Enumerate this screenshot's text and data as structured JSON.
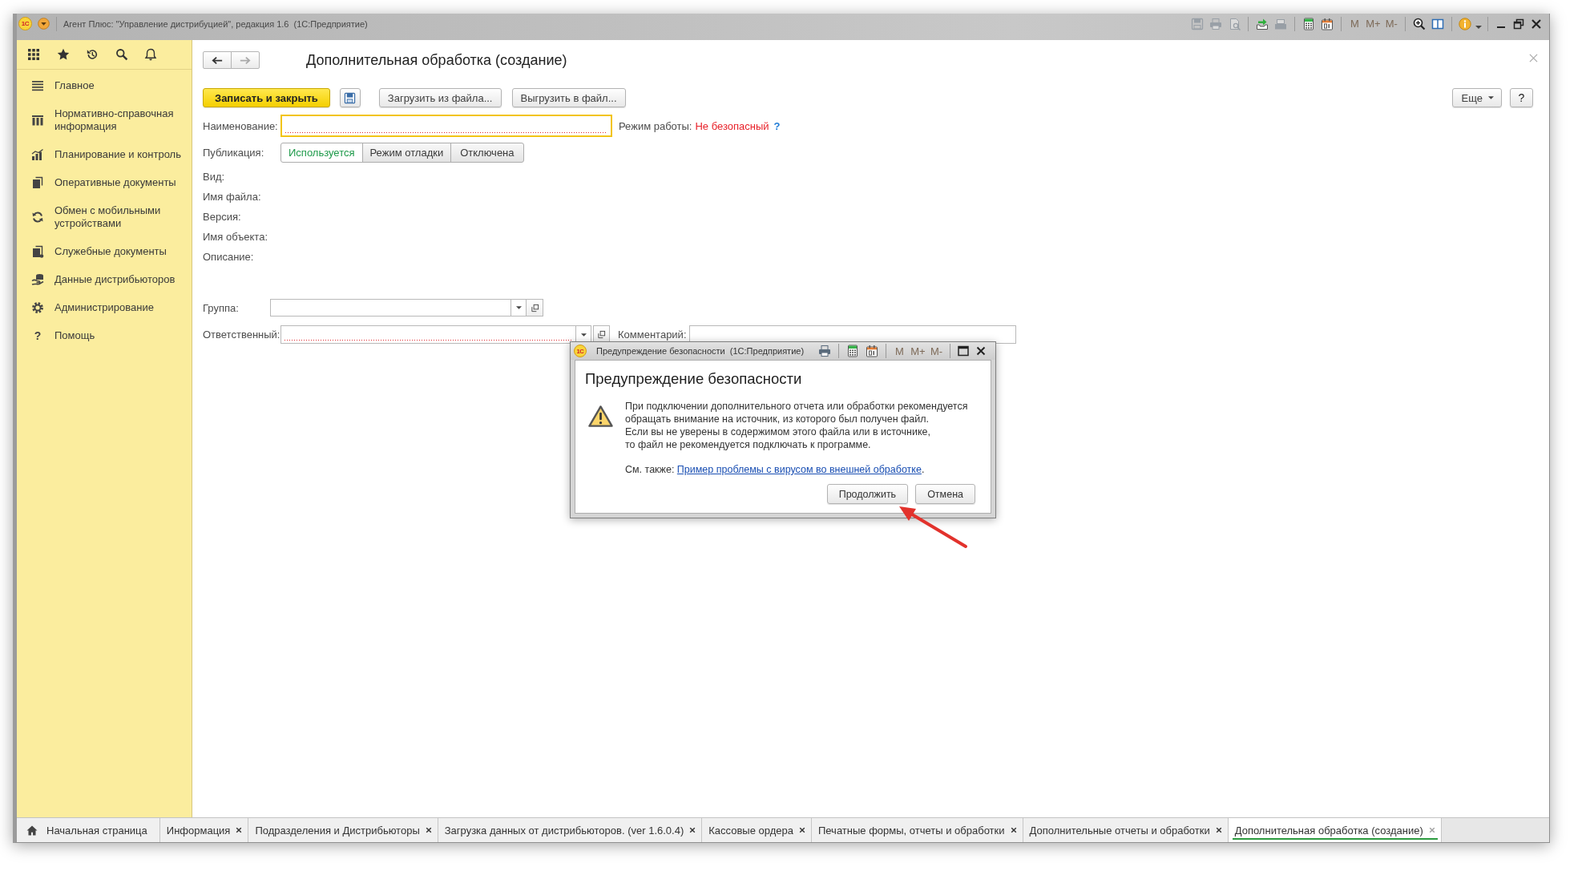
{
  "window": {
    "logo": "1С",
    "title": "Агент Плюс: \"Управление дистрибуцией\", редакция 1.6  (1С:Предприятие)",
    "tool_groups": [
      [
        {
          "kind": "save",
          "disabled": true
        },
        {
          "kind": "print",
          "disabled": true
        },
        {
          "kind": "preview",
          "disabled": true
        }
      ],
      [
        {
          "kind": "export",
          "disabled": false
        },
        {
          "kind": "scanner",
          "disabled": true
        }
      ],
      [
        {
          "kind": "calculator",
          "disabled": false
        },
        {
          "kind": "calendar",
          "disabled": false
        }
      ],
      [
        {
          "kind": "memory",
          "label": "M",
          "disabled": true
        },
        {
          "kind": "memory",
          "label": "M+",
          "disabled": true
        },
        {
          "kind": "memory",
          "label": "M-",
          "disabled": true
        }
      ],
      [
        {
          "kind": "zoom",
          "disabled": false
        },
        {
          "kind": "panels",
          "disabled": false
        }
      ],
      [
        {
          "kind": "info",
          "disabled": false
        }
      ]
    ]
  },
  "sidebar": {
    "items": [
      {
        "kind": "main",
        "label": "Главное"
      },
      {
        "kind": "catalogs",
        "label": "Нормативно-справочная информация"
      },
      {
        "kind": "planning",
        "label": "Планирование и контроль"
      },
      {
        "kind": "documents",
        "label": "Оперативные документы"
      },
      {
        "kind": "exchange",
        "label": "Обмен с мобильными устройствами"
      },
      {
        "kind": "service",
        "label": "Служебные документы"
      },
      {
        "kind": "distributors",
        "label": "Данные дистрибьюторов"
      },
      {
        "kind": "admin",
        "label": "Администрирование"
      },
      {
        "kind": "help",
        "label": "Помощь",
        "glyph": "?"
      }
    ]
  },
  "form": {
    "title": "Дополнительная обработка (создание)",
    "nav": [
      {
        "kind": "back",
        "disabled": false
      },
      {
        "kind": "forward",
        "disabled": true
      }
    ],
    "toolbar": [
      {
        "kind": "primary",
        "label": "Записать и закрыть"
      },
      {
        "kind": "save"
      },
      {
        "kind": "default",
        "label": "Загрузить из файла..."
      },
      {
        "kind": "default",
        "label": "Выгрузить в файл..."
      }
    ],
    "more_button": {
      "label": "Еще"
    },
    "help_button": {
      "label": "?"
    },
    "name_field": {
      "label": "Наименование:",
      "focused": true,
      "required": true
    },
    "mode": {
      "label": "Режим работы:",
      "value": "Не безопасный",
      "help": "?"
    },
    "publication": {
      "label": "Публикация:",
      "options": [
        {
          "label": "Используется",
          "selected": true
        },
        {
          "label": "Режим отладки",
          "selected": false
        },
        {
          "label": "Отключена",
          "selected": false
        }
      ]
    },
    "details": [
      "Вид:",
      "Имя файла:",
      "Версия:",
      "Имя объекта:",
      "Описание:"
    ],
    "group_field": {
      "label": "Группа:",
      "focused": false,
      "required": false
    },
    "responsible_field": {
      "label": "Ответственный:",
      "focused": false,
      "required": true
    },
    "comment_field": {
      "label": "Комментарий:",
      "focused": false,
      "required": false
    }
  },
  "dialog": {
    "logo": "1С",
    "title": "Предупреждение безопасности  (1С:Предприятие)",
    "tool_groups": [
      [
        {
          "kind": "print",
          "disabled": false
        }
      ],
      [
        {
          "kind": "calculator",
          "disabled": false
        },
        {
          "kind": "calendar",
          "disabled": false
        }
      ],
      [
        {
          "kind": "memory",
          "label": "M",
          "disabled": true
        },
        {
          "kind": "memory",
          "label": "M+",
          "disabled": true
        },
        {
          "kind": "memory",
          "label": "M-",
          "disabled": true
        }
      ]
    ],
    "heading": "Предупреждение безопасности",
    "message": "При подключении дополнительного отчета или обработки рекомендуется\nобращать внимание на источник, из которого был получен файл.\nЕсли вы не уверены в содержимом этого файла или в источнике,\nто файл не рекомендуется подключать к программе.",
    "see_also": {
      "label": "См. также:",
      "link": "Пример проблемы с вирусом во внешней обработке",
      "end": "."
    },
    "buttons": [
      {
        "label": "Продолжить"
      },
      {
        "label": "Отмена"
      }
    ]
  },
  "tabs": [
    {
      "kind": "home",
      "label": "Начальная страница",
      "selected": false
    },
    {
      "kind": "page",
      "label": "Информация",
      "selected": false
    },
    {
      "kind": "page",
      "label": "Подразделения и Дистрибьюторы",
      "selected": false
    },
    {
      "kind": "page",
      "label": "Загрузка данных от дистрибьюторов. (ver 1.6.0.4)",
      "selected": false
    },
    {
      "kind": "page",
      "label": "Кассовые ордера",
      "selected": false
    },
    {
      "kind": "page",
      "label": "Печатные формы, отчеты и обработки",
      "selected": false
    },
    {
      "kind": "page",
      "label": "Дополнительные отчеты и обработки",
      "selected": false
    },
    {
      "kind": "page",
      "label": "Дополнительная обработка (создание)",
      "selected": true
    }
  ],
  "annotations": [
    {
      "kind": "arrow"
    }
  ]
}
